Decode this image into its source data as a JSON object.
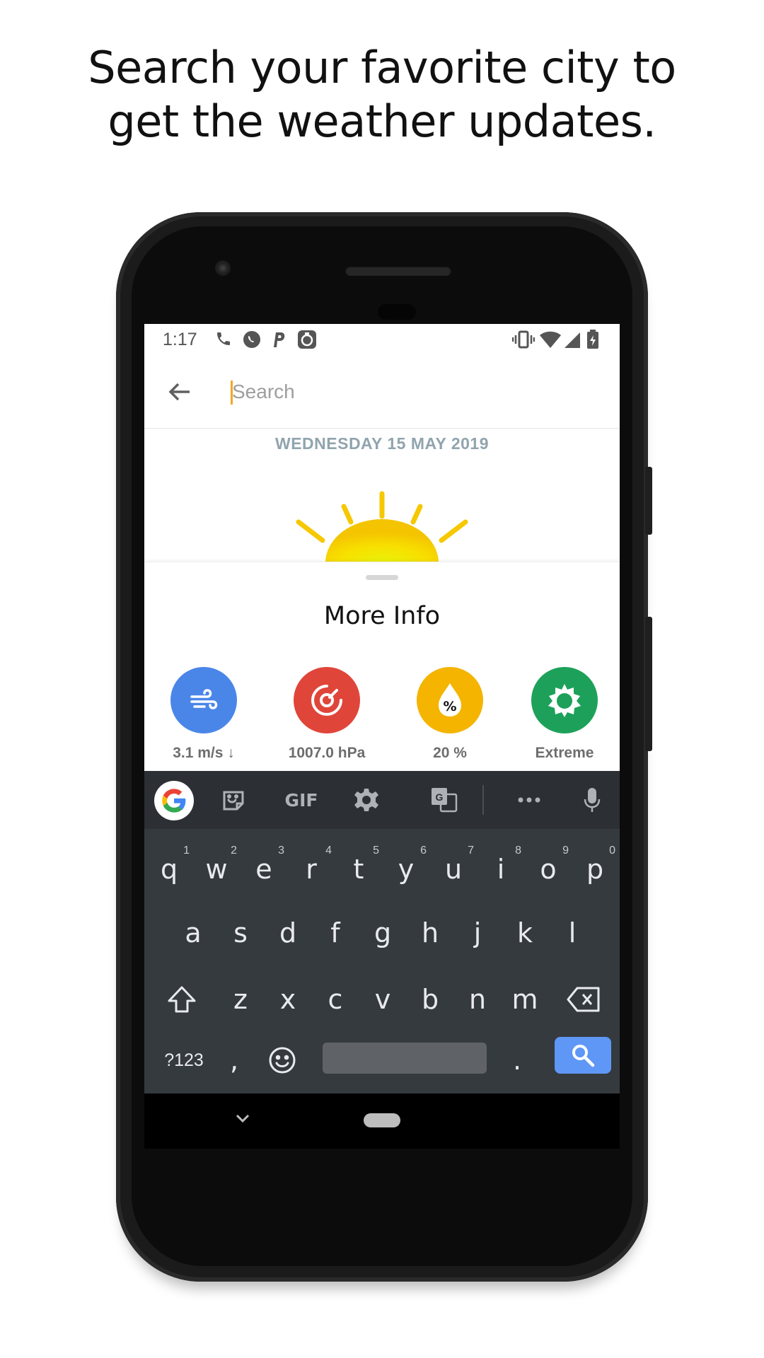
{
  "headline": {
    "line1": "Search your favorite city to",
    "line2": "get the weather updates."
  },
  "status_bar": {
    "time": "1:17",
    "left_icons": [
      "phone-icon",
      "whatsapp-icon",
      "parking-p-icon",
      "app-notification-icon"
    ],
    "right_icons": [
      "vibrate-icon",
      "wifi-icon",
      "signal-icon",
      "battery-charging-icon"
    ]
  },
  "search": {
    "placeholder": "Search",
    "value": ""
  },
  "date": "WEDNESDAY  15  MAY  2019",
  "sheet": {
    "title": "More Info",
    "items": [
      {
        "icon": "wind-icon",
        "value": "3.1 m/s ↓",
        "color": "#4a86e8"
      },
      {
        "icon": "pressure-icon",
        "value": "1007.0 hPa",
        "color": "#e0453a"
      },
      {
        "icon": "humidity-icon",
        "value": "20 %",
        "color": "#f4b400"
      },
      {
        "icon": "uv-sun-icon",
        "value": "Extreme",
        "color": "#1da15a"
      }
    ]
  },
  "keyboard": {
    "toolbar": [
      "google-icon",
      "sticker-icon",
      "GIF",
      "settings-gear-icon",
      "translate-icon",
      "more-dots-icon",
      "mic-icon"
    ],
    "gif_label": "GIF",
    "row1": [
      {
        "k": "q",
        "h": "1"
      },
      {
        "k": "w",
        "h": "2"
      },
      {
        "k": "e",
        "h": "3"
      },
      {
        "k": "r",
        "h": "4"
      },
      {
        "k": "t",
        "h": "5"
      },
      {
        "k": "y",
        "h": "6"
      },
      {
        "k": "u",
        "h": "7"
      },
      {
        "k": "i",
        "h": "8"
      },
      {
        "k": "o",
        "h": "9"
      },
      {
        "k": "p",
        "h": "0"
      }
    ],
    "row2": [
      "a",
      "s",
      "d",
      "f",
      "g",
      "h",
      "j",
      "k",
      "l"
    ],
    "row3": [
      "z",
      "x",
      "c",
      "v",
      "b",
      "n",
      "m"
    ],
    "sym_label": "?123",
    "comma": ",",
    "period": "."
  },
  "colors": {
    "accent_caret": "#f5a623",
    "sun": "#f6c800",
    "keyboard_bg": "#353a3f",
    "enter_key": "#5e97f6"
  }
}
